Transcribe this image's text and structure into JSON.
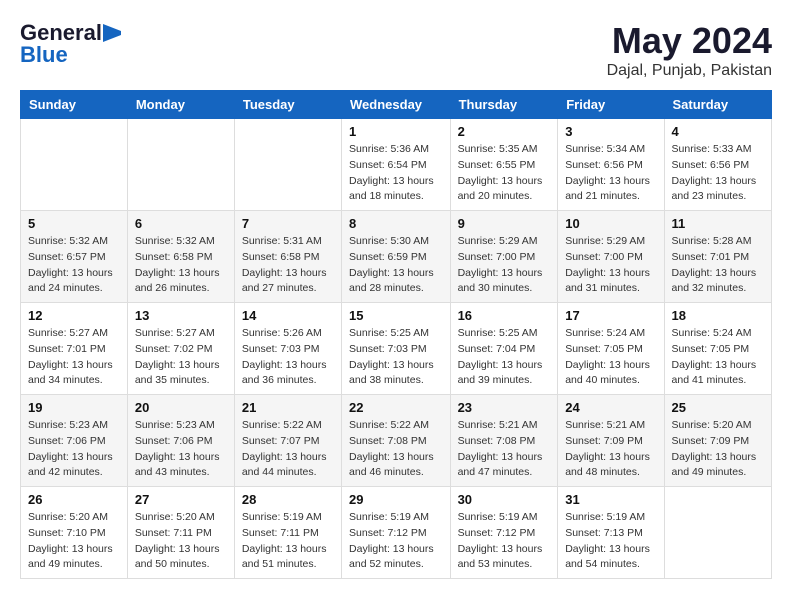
{
  "logo": {
    "general": "General",
    "blue": "Blue"
  },
  "title": {
    "month": "May 2024",
    "location": "Dajal, Punjab, Pakistan"
  },
  "headers": [
    "Sunday",
    "Monday",
    "Tuesday",
    "Wednesday",
    "Thursday",
    "Friday",
    "Saturday"
  ],
  "weeks": [
    [
      {
        "day": "",
        "info": ""
      },
      {
        "day": "",
        "info": ""
      },
      {
        "day": "",
        "info": ""
      },
      {
        "day": "1",
        "info": "Sunrise: 5:36 AM\nSunset: 6:54 PM\nDaylight: 13 hours\nand 18 minutes."
      },
      {
        "day": "2",
        "info": "Sunrise: 5:35 AM\nSunset: 6:55 PM\nDaylight: 13 hours\nand 20 minutes."
      },
      {
        "day": "3",
        "info": "Sunrise: 5:34 AM\nSunset: 6:56 PM\nDaylight: 13 hours\nand 21 minutes."
      },
      {
        "day": "4",
        "info": "Sunrise: 5:33 AM\nSunset: 6:56 PM\nDaylight: 13 hours\nand 23 minutes."
      }
    ],
    [
      {
        "day": "5",
        "info": "Sunrise: 5:32 AM\nSunset: 6:57 PM\nDaylight: 13 hours\nand 24 minutes."
      },
      {
        "day": "6",
        "info": "Sunrise: 5:32 AM\nSunset: 6:58 PM\nDaylight: 13 hours\nand 26 minutes."
      },
      {
        "day": "7",
        "info": "Sunrise: 5:31 AM\nSunset: 6:58 PM\nDaylight: 13 hours\nand 27 minutes."
      },
      {
        "day": "8",
        "info": "Sunrise: 5:30 AM\nSunset: 6:59 PM\nDaylight: 13 hours\nand 28 minutes."
      },
      {
        "day": "9",
        "info": "Sunrise: 5:29 AM\nSunset: 7:00 PM\nDaylight: 13 hours\nand 30 minutes."
      },
      {
        "day": "10",
        "info": "Sunrise: 5:29 AM\nSunset: 7:00 PM\nDaylight: 13 hours\nand 31 minutes."
      },
      {
        "day": "11",
        "info": "Sunrise: 5:28 AM\nSunset: 7:01 PM\nDaylight: 13 hours\nand 32 minutes."
      }
    ],
    [
      {
        "day": "12",
        "info": "Sunrise: 5:27 AM\nSunset: 7:01 PM\nDaylight: 13 hours\nand 34 minutes."
      },
      {
        "day": "13",
        "info": "Sunrise: 5:27 AM\nSunset: 7:02 PM\nDaylight: 13 hours\nand 35 minutes."
      },
      {
        "day": "14",
        "info": "Sunrise: 5:26 AM\nSunset: 7:03 PM\nDaylight: 13 hours\nand 36 minutes."
      },
      {
        "day": "15",
        "info": "Sunrise: 5:25 AM\nSunset: 7:03 PM\nDaylight: 13 hours\nand 38 minutes."
      },
      {
        "day": "16",
        "info": "Sunrise: 5:25 AM\nSunset: 7:04 PM\nDaylight: 13 hours\nand 39 minutes."
      },
      {
        "day": "17",
        "info": "Sunrise: 5:24 AM\nSunset: 7:05 PM\nDaylight: 13 hours\nand 40 minutes."
      },
      {
        "day": "18",
        "info": "Sunrise: 5:24 AM\nSunset: 7:05 PM\nDaylight: 13 hours\nand 41 minutes."
      }
    ],
    [
      {
        "day": "19",
        "info": "Sunrise: 5:23 AM\nSunset: 7:06 PM\nDaylight: 13 hours\nand 42 minutes."
      },
      {
        "day": "20",
        "info": "Sunrise: 5:23 AM\nSunset: 7:06 PM\nDaylight: 13 hours\nand 43 minutes."
      },
      {
        "day": "21",
        "info": "Sunrise: 5:22 AM\nSunset: 7:07 PM\nDaylight: 13 hours\nand 44 minutes."
      },
      {
        "day": "22",
        "info": "Sunrise: 5:22 AM\nSunset: 7:08 PM\nDaylight: 13 hours\nand 46 minutes."
      },
      {
        "day": "23",
        "info": "Sunrise: 5:21 AM\nSunset: 7:08 PM\nDaylight: 13 hours\nand 47 minutes."
      },
      {
        "day": "24",
        "info": "Sunrise: 5:21 AM\nSunset: 7:09 PM\nDaylight: 13 hours\nand 48 minutes."
      },
      {
        "day": "25",
        "info": "Sunrise: 5:20 AM\nSunset: 7:09 PM\nDaylight: 13 hours\nand 49 minutes."
      }
    ],
    [
      {
        "day": "26",
        "info": "Sunrise: 5:20 AM\nSunset: 7:10 PM\nDaylight: 13 hours\nand 49 minutes."
      },
      {
        "day": "27",
        "info": "Sunrise: 5:20 AM\nSunset: 7:11 PM\nDaylight: 13 hours\nand 50 minutes."
      },
      {
        "day": "28",
        "info": "Sunrise: 5:19 AM\nSunset: 7:11 PM\nDaylight: 13 hours\nand 51 minutes."
      },
      {
        "day": "29",
        "info": "Sunrise: 5:19 AM\nSunset: 7:12 PM\nDaylight: 13 hours\nand 52 minutes."
      },
      {
        "day": "30",
        "info": "Sunrise: 5:19 AM\nSunset: 7:12 PM\nDaylight: 13 hours\nand 53 minutes."
      },
      {
        "day": "31",
        "info": "Sunrise: 5:19 AM\nSunset: 7:13 PM\nDaylight: 13 hours\nand 54 minutes."
      },
      {
        "day": "",
        "info": ""
      }
    ]
  ]
}
